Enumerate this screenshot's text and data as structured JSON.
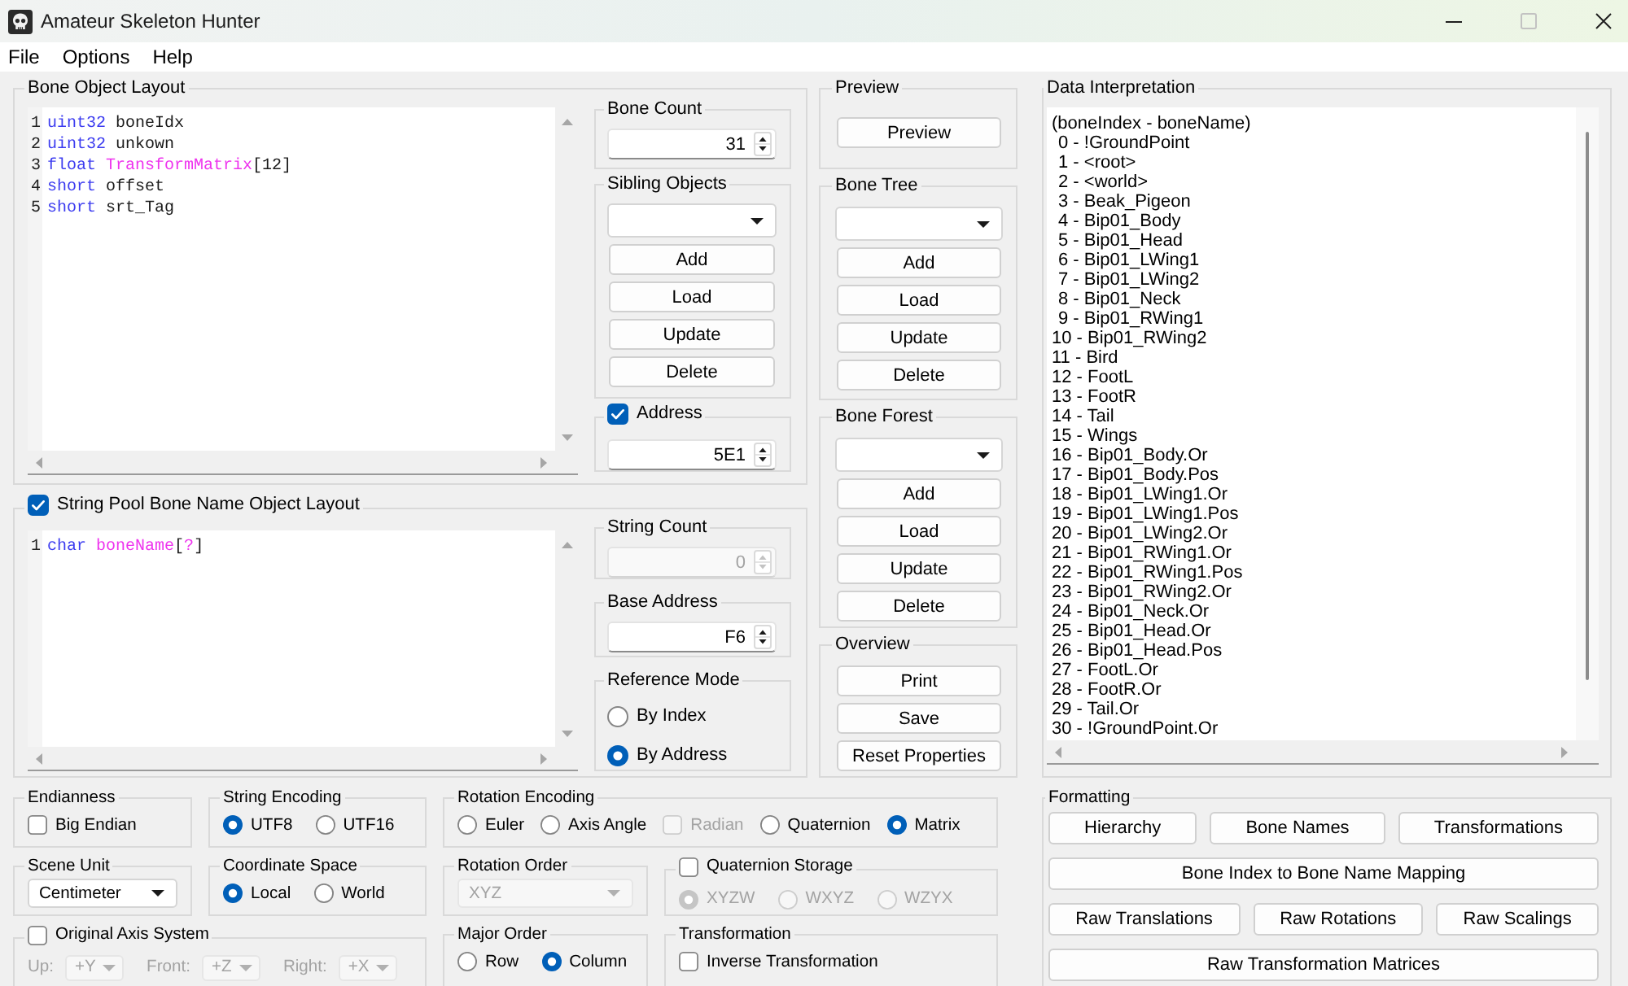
{
  "window": {
    "title": "Amateur Skeleton Hunter",
    "controls": [
      {
        "kind": "minimize",
        "disabled": false
      },
      {
        "kind": "maximize",
        "disabled": true
      },
      {
        "kind": "close",
        "disabled": false
      }
    ]
  },
  "menu": [
    "File",
    "Options",
    "Help"
  ],
  "bone_object_layout": {
    "title": "Bone Object Layout",
    "code": [
      {
        "number": "1",
        "tokens": [
          {
            "kind": "keyword",
            "text": "uint32"
          },
          {
            "kind": "plain",
            "text": " boneIdx"
          }
        ]
      },
      {
        "number": "2",
        "tokens": [
          {
            "kind": "keyword",
            "text": "uint32"
          },
          {
            "kind": "plain",
            "text": " unkown"
          }
        ]
      },
      {
        "number": "3",
        "tokens": [
          {
            "kind": "keyword",
            "text": "float"
          },
          {
            "kind": "highlight",
            "text": " TransformMatrix"
          },
          {
            "kind": "plain",
            "text": "[12]"
          }
        ]
      },
      {
        "number": "4",
        "tokens": [
          {
            "kind": "keyword",
            "text": "short"
          },
          {
            "kind": "plain",
            "text": " offset"
          }
        ]
      },
      {
        "number": "5",
        "tokens": [
          {
            "kind": "keyword",
            "text": "short"
          },
          {
            "kind": "plain",
            "text": " srt_Tag"
          }
        ]
      }
    ],
    "groups": [
      {
        "title": "Bone Count",
        "items": [
          {
            "kind": "spin",
            "value": "31"
          }
        ]
      },
      {
        "title": "Sibling Objects",
        "items": [
          {
            "kind": "dropdown"
          },
          {
            "kind": "button",
            "label": "Add"
          },
          {
            "kind": "button",
            "label": "Load"
          },
          {
            "kind": "button",
            "label": "Update"
          },
          {
            "kind": "button",
            "label": "Delete"
          }
        ]
      },
      {
        "title": "Address",
        "checked": true,
        "items": [
          {
            "kind": "spin",
            "value": "5E1"
          }
        ]
      }
    ]
  },
  "string_pool_layout": {
    "title": "String Pool Bone Name Object Layout",
    "checked": true,
    "code": [
      {
        "number": "1",
        "tokens": [
          {
            "kind": "keyword",
            "text": "char"
          },
          {
            "kind": "highlight",
            "text": " boneName"
          },
          {
            "kind": "plain",
            "text": "["
          },
          {
            "kind": "highlight",
            "text": "?"
          },
          {
            "kind": "plain",
            "text": "]"
          }
        ]
      }
    ],
    "groups": [
      {
        "title": "String Count",
        "items": [
          {
            "kind": "spin",
            "value": "0",
            "disabled": true
          }
        ]
      },
      {
        "title": "Base Address",
        "items": [
          {
            "kind": "spin",
            "value": "F6"
          }
        ]
      },
      {
        "title": "Reference Mode",
        "items": [
          {
            "kind": "radio",
            "label": "By Index",
            "selected": false
          },
          {
            "kind": "radio",
            "label": "By Address",
            "selected": true
          }
        ]
      }
    ]
  },
  "tool_groups": [
    {
      "title": "Preview",
      "items": [
        {
          "kind": "button",
          "label": "Preview"
        }
      ]
    },
    {
      "title": "Bone Tree",
      "items": [
        {
          "kind": "dropdown"
        },
        {
          "kind": "button",
          "label": "Add"
        },
        {
          "kind": "button",
          "label": "Load"
        },
        {
          "kind": "button",
          "label": "Update"
        },
        {
          "kind": "button",
          "label": "Delete"
        }
      ]
    },
    {
      "title": "Bone Forest",
      "items": [
        {
          "kind": "dropdown"
        },
        {
          "kind": "button",
          "label": "Add"
        },
        {
          "kind": "button",
          "label": "Load"
        },
        {
          "kind": "button",
          "label": "Update"
        },
        {
          "kind": "button",
          "label": "Delete"
        }
      ]
    },
    {
      "title": "Overview",
      "items": [
        {
          "kind": "button",
          "label": "Print"
        },
        {
          "kind": "button",
          "label": "Save"
        },
        {
          "kind": "button",
          "label": "Reset Properties"
        }
      ]
    }
  ],
  "data_interpretation": {
    "title": "Data Interpretation",
    "lines": [
      "(boneIndex - boneName)",
      "0 - !GroundPoint",
      "1 - <root>",
      "2 - <world>",
      "3 - Beak_Pigeon",
      "4 - Bip01_Body",
      "5 - Bip01_Head",
      "6 - Bip01_LWing1",
      "7 - Bip01_LWing2",
      "8 - Bip01_Neck",
      "9 - Bip01_RWing1",
      "10 - Bip01_RWing2",
      "11 - Bird",
      "12 - FootL",
      "13 - FootR",
      "14 - Tail",
      "15 - Wings",
      "16 - Bip01_Body.Or",
      "17 - Bip01_Body.Pos",
      "18 - Bip01_LWing1.Or",
      "19 - Bip01_LWing1.Pos",
      "20 - Bip01_LWing2.Or",
      "21 - Bip01_RWing1.Or",
      "22 - Bip01_RWing1.Pos",
      "23 - Bip01_RWing2.Or",
      "24 - Bip01_Neck.Or",
      "25 - Bip01_Head.Or",
      "26 - Bip01_Head.Pos",
      "27 - FootL.Or",
      "28 - FootR.Or",
      "29 - Tail.Or",
      "30 - !GroundPoint.Or"
    ]
  },
  "settings": [
    {
      "title": "Endianness",
      "items": [
        {
          "kind": "checkbox",
          "label": "Big Endian",
          "checked": false
        }
      ]
    },
    {
      "title": "String Encoding",
      "items": [
        {
          "kind": "radio",
          "label": "UTF8",
          "selected": true
        },
        {
          "kind": "radio",
          "label": "UTF16",
          "selected": false
        }
      ]
    },
    {
      "title": "Rotation Encoding",
      "items": [
        {
          "kind": "radio",
          "label": "Euler",
          "selected": false,
          "disabled": false
        },
        {
          "kind": "radio",
          "label": "Axis Angle",
          "selected": false,
          "disabled": false
        },
        {
          "kind": "checkbox",
          "label": "Radian",
          "checked": false,
          "disabled": true
        },
        {
          "kind": "radio",
          "label": "Quaternion",
          "selected": false,
          "disabled": false
        },
        {
          "kind": "radio",
          "label": "Matrix",
          "selected": true,
          "disabled": false
        }
      ]
    },
    {
      "title": "Scene Unit",
      "items": [
        {
          "kind": "dropdown",
          "value": "Centimeter"
        }
      ]
    },
    {
      "title": "Coordinate Space",
      "items": [
        {
          "kind": "radio",
          "label": "Local",
          "selected": true
        },
        {
          "kind": "radio",
          "label": "World",
          "selected": false
        }
      ]
    },
    {
      "title": "Rotation Order",
      "items": [
        {
          "kind": "dropdown",
          "value": "XYZ",
          "disabled": true
        }
      ]
    },
    {
      "title": "Quaternion Storage",
      "checked": false,
      "items": [
        {
          "kind": "radio",
          "label": "XYZW",
          "selected": true,
          "disabled": true
        },
        {
          "kind": "radio",
          "label": "WXYZ",
          "selected": false,
          "disabled": true
        },
        {
          "kind": "radio",
          "label": "WZYX",
          "selected": false,
          "disabled": true
        }
      ]
    },
    {
      "title": "Original Axis System",
      "checked": false,
      "items": [
        {
          "kind": "axis",
          "label": "Up:",
          "value": "+Y",
          "disabled": true
        },
        {
          "kind": "axis",
          "label": "Front:",
          "value": "+Z",
          "disabled": true
        },
        {
          "kind": "axis",
          "label": "Right:",
          "value": "+X",
          "disabled": true
        }
      ]
    },
    {
      "title": "Major Order",
      "items": [
        {
          "kind": "radio",
          "label": "Row",
          "selected": false
        },
        {
          "kind": "radio",
          "label": "Column",
          "selected": true
        }
      ]
    },
    {
      "title": "Transformation",
      "items": [
        {
          "kind": "checkbox",
          "label": "Inverse Transformation",
          "checked": false
        }
      ]
    }
  ],
  "formatting": {
    "title": "Formatting",
    "rows": [
      [
        "Hierarchy",
        "Bone Names",
        "Transformations"
      ],
      [
        "Bone Index to Bone Name Mapping"
      ],
      [
        "Raw Translations",
        "Raw Rotations",
        "Raw Scalings"
      ],
      [
        "Raw Transformation Matrices"
      ]
    ]
  }
}
